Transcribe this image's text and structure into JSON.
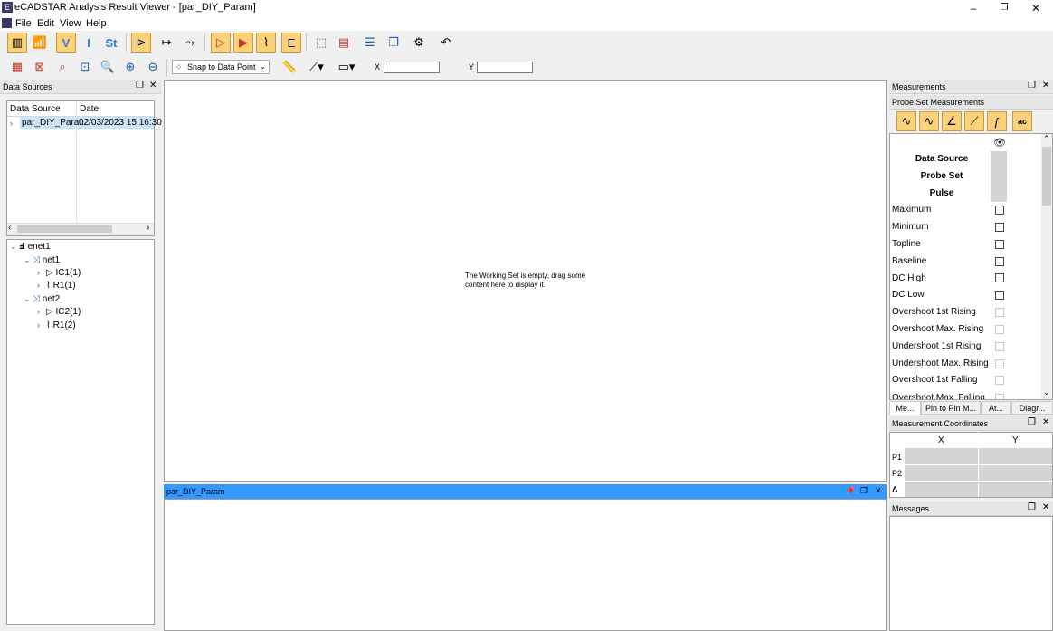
{
  "window": {
    "title": "eCADSTAR Analysis Result Viewer - [par_DIY_Param]",
    "app_icon": "E",
    "minimize": "–",
    "restore": "❐",
    "close": "✕"
  },
  "menu": {
    "items": [
      "File",
      "Edit",
      "View",
      "Help"
    ]
  },
  "toolbar2": {
    "snap_mode": "Snap to Data Point",
    "x_label": "X",
    "y_label": "Y",
    "x_value": "",
    "y_value": ""
  },
  "data_sources": {
    "title": "Data Sources",
    "columns": [
      "Data Source",
      "Date"
    ],
    "rows": [
      {
        "source": "par_DIY_Para...",
        "date": "02/03/2023 15:16:30"
      }
    ],
    "tree": {
      "root": "enet1",
      "nets": [
        {
          "name": "net1",
          "items": [
            "IC1(1)",
            "R1(1)"
          ]
        },
        {
          "name": "net2",
          "items": [
            "IC2(1)",
            "R1(2)"
          ]
        }
      ]
    }
  },
  "main": {
    "empty_message_1": "The Working Set is empty, drag some",
    "empty_message_2": "content here to display it."
  },
  "result_panel": {
    "title": "par_DIY_Param"
  },
  "measurements": {
    "title": "Measurements",
    "subtitle": "Probe Set Measurements",
    "headers": [
      "Data Source",
      "Probe Set",
      "Pulse"
    ],
    "items": [
      {
        "label": "Maximum",
        "enabled": true
      },
      {
        "label": "Minimum",
        "enabled": true
      },
      {
        "label": "Topline",
        "enabled": true
      },
      {
        "label": "Baseline",
        "enabled": true
      },
      {
        "label": "DC High",
        "enabled": true
      },
      {
        "label": "DC Low",
        "enabled": true
      },
      {
        "label": "Overshoot 1st Rising",
        "enabled": false
      },
      {
        "label": "Overshoot Max. Rising",
        "enabled": false
      },
      {
        "label": "Undershoot 1st Rising",
        "enabled": false
      },
      {
        "label": "Undershoot Max. Rising",
        "enabled": false
      },
      {
        "label": "Overshoot 1st Falling",
        "enabled": false
      },
      {
        "label": "Overshoot Max. Falling",
        "enabled": false
      }
    ],
    "tabs": [
      "Me...",
      "Pin to Pin M...",
      "At...",
      "Diagr..."
    ]
  },
  "measurement_coords": {
    "title": "Measurement Coordinates",
    "col_x": "X",
    "col_y": "Y",
    "rows": [
      "P1",
      "P2",
      "Δ"
    ]
  },
  "messages": {
    "title": "Messages"
  },
  "colors": {
    "accent": "#3399ff",
    "toggle_on": "#fbd27a"
  }
}
